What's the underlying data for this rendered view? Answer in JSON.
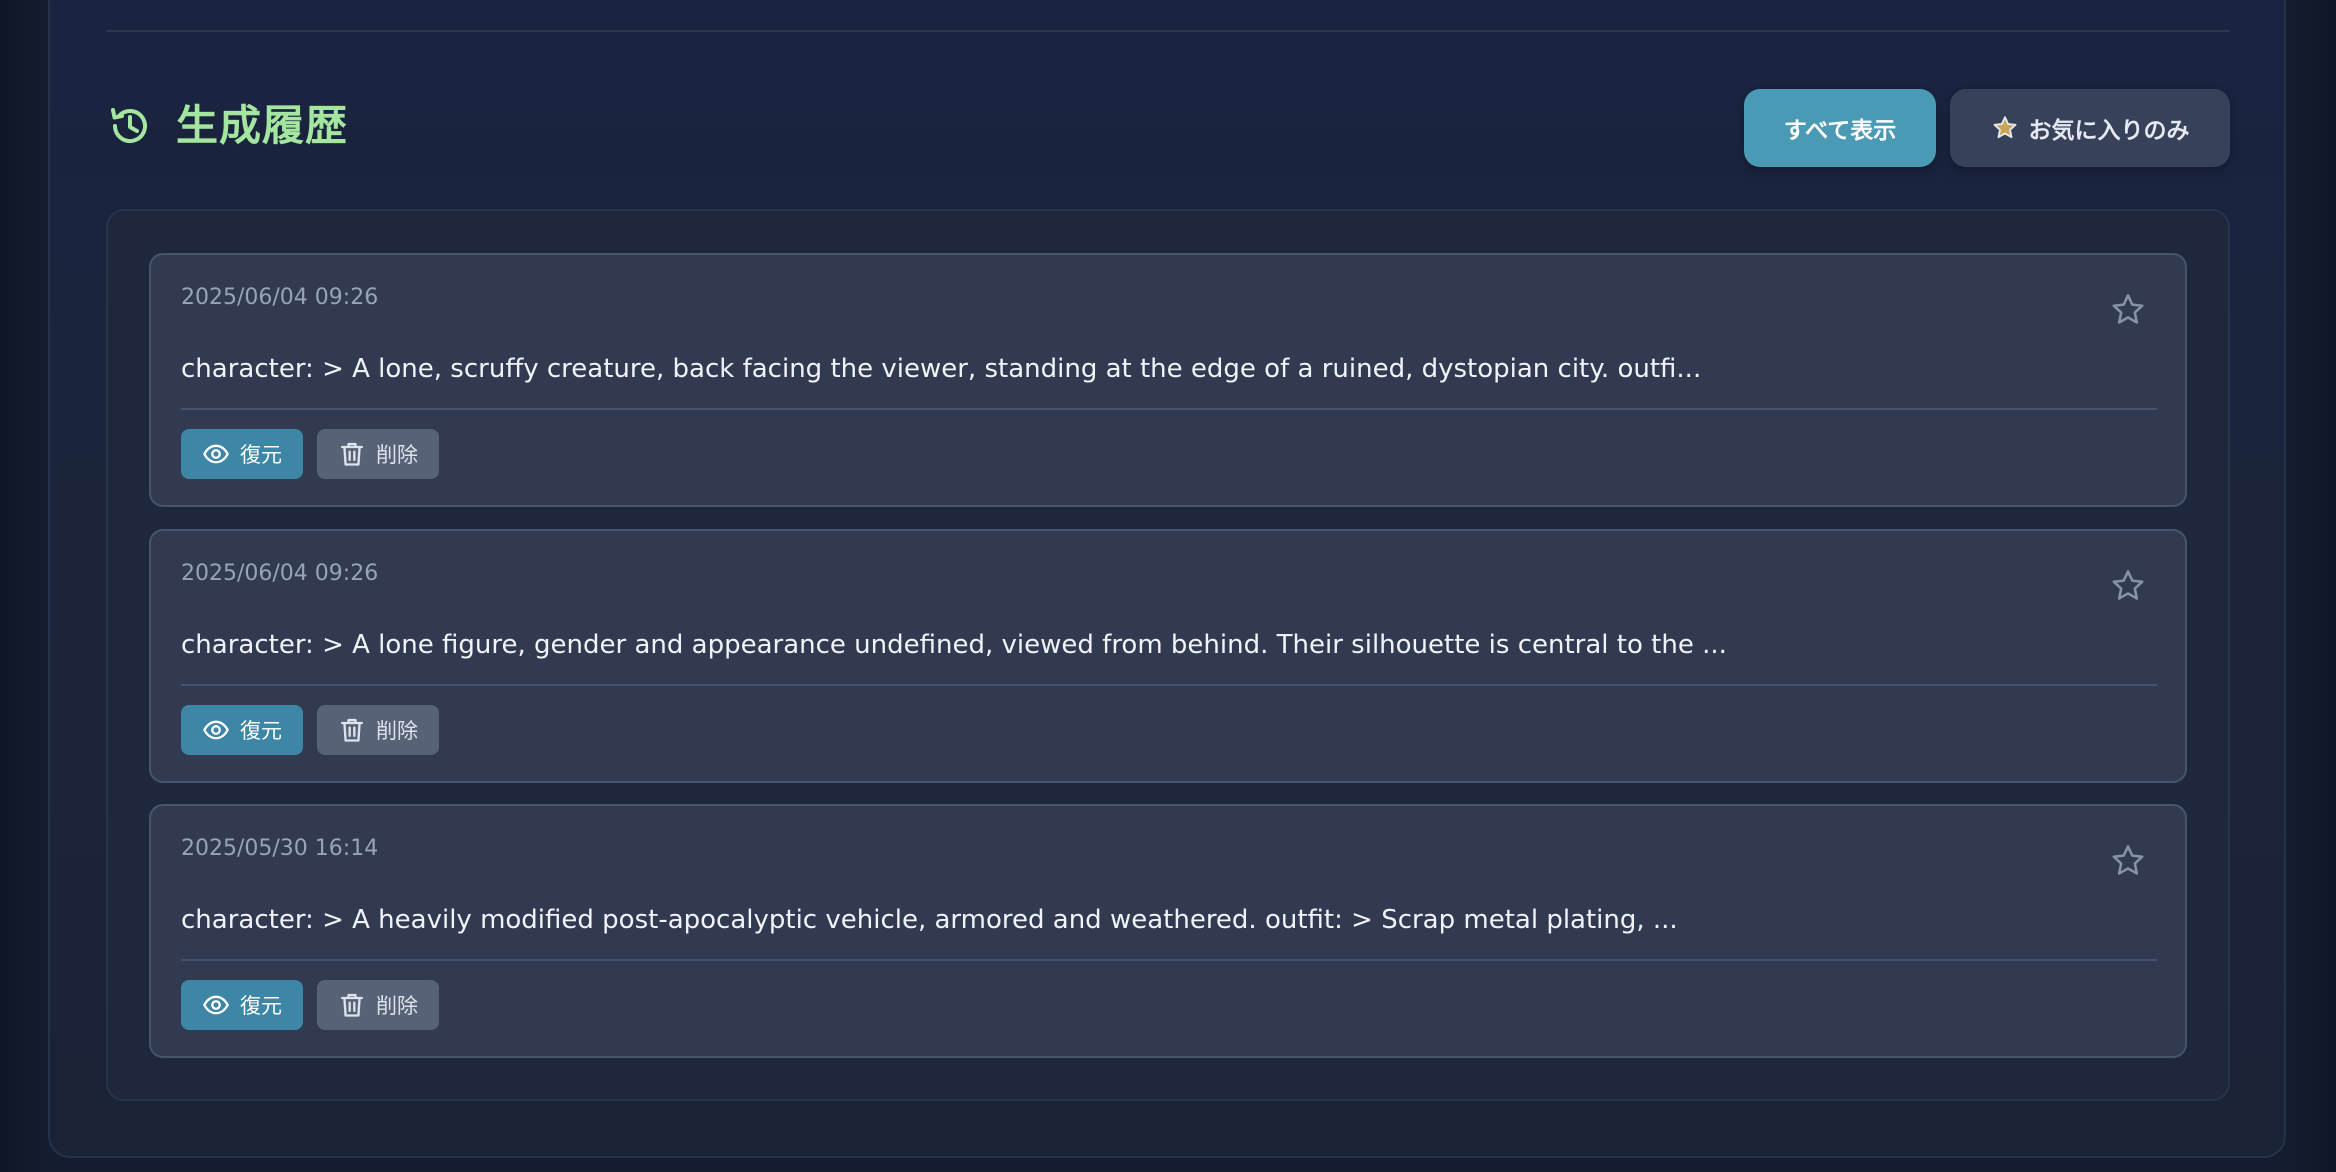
{
  "header": {
    "title": "生成履歴",
    "icon": "history-icon",
    "title_color": "#a4e5a0"
  },
  "filters": {
    "show_all_label": "すべて表示",
    "favorites_only_label": "お気に入りのみ",
    "active": "show_all",
    "active_color": "#4b9ab5"
  },
  "history": {
    "items": [
      {
        "date": "2025/06/04 09:26",
        "text": "character: > A lone, scruffy creature, back facing the viewer, standing at the edge of a ruined, dystopian city. outfi...",
        "favorited": false,
        "restore_label": "復元",
        "delete_label": "削除"
      },
      {
        "date": "2025/06/04 09:26",
        "text": "character: > A lone figure, gender and appearance undefined, viewed from behind. Their silhouette is central to the ...",
        "favorited": false,
        "restore_label": "復元",
        "delete_label": "削除"
      },
      {
        "date": "2025/05/30 16:14",
        "text": "character: > A heavily modified post-apocalyptic vehicle, armored and weathered. outfit: > Scrap metal plating, ...",
        "favorited": false,
        "restore_label": "復元",
        "delete_label": "削除"
      }
    ]
  }
}
